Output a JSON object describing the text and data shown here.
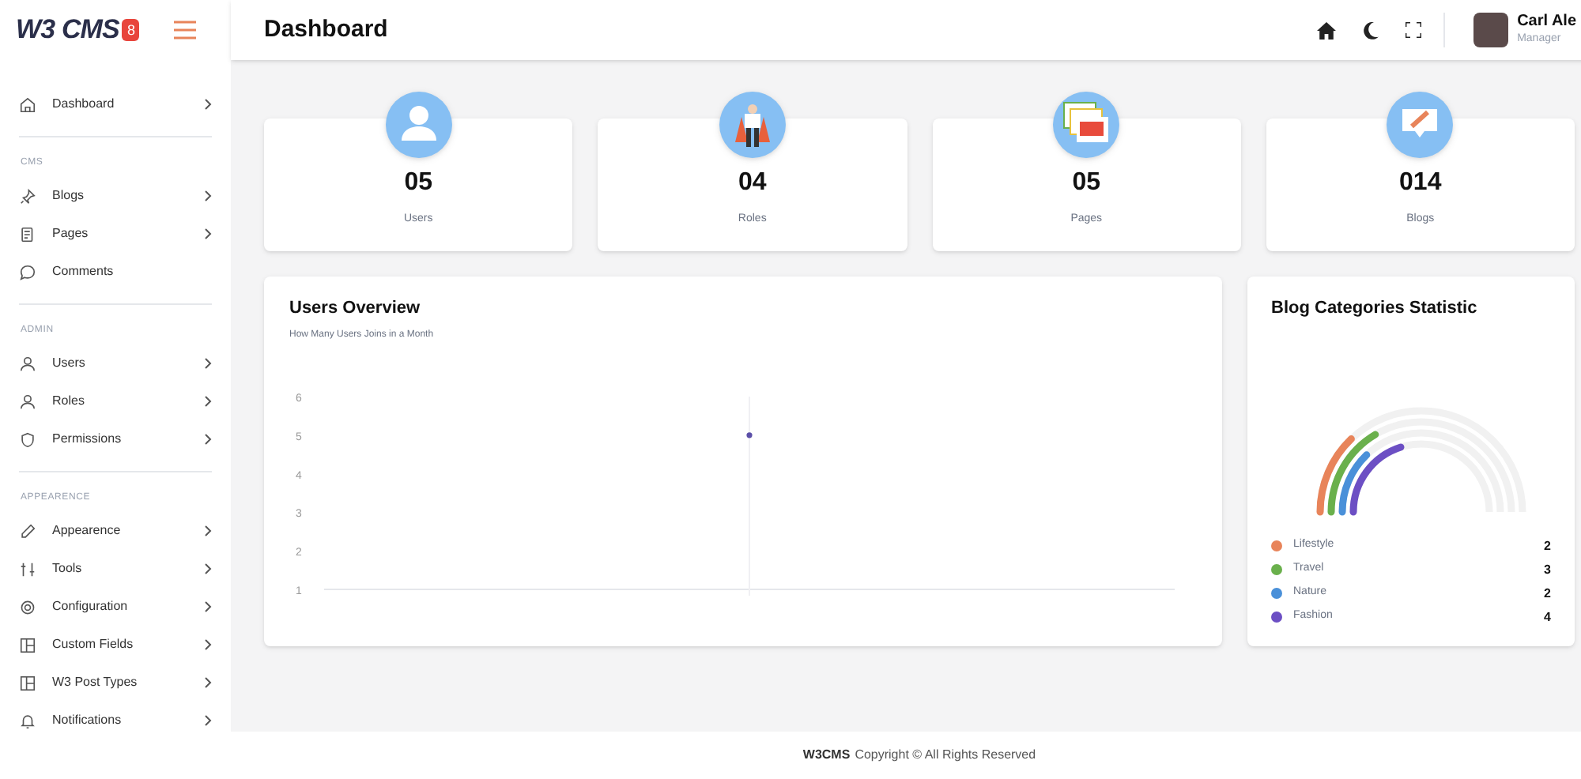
{
  "logo": {
    "text": "W3 CMS",
    "badge": "8"
  },
  "header": {
    "title": "Dashboard",
    "user": {
      "name": "Carl Ale",
      "role": "Manager"
    }
  },
  "sidebar": {
    "sections": [
      {
        "items": [
          {
            "label": "Dashboard",
            "has_submenu": true
          }
        ]
      },
      {
        "heading": "CMS",
        "items": [
          {
            "label": "Blogs",
            "has_submenu": true
          },
          {
            "label": "Pages",
            "has_submenu": true
          },
          {
            "label": "Comments",
            "has_submenu": false
          }
        ]
      },
      {
        "heading": "ADMIN",
        "items": [
          {
            "label": "Users",
            "has_submenu": true
          },
          {
            "label": "Roles",
            "has_submenu": true
          },
          {
            "label": "Permissions",
            "has_submenu": true
          }
        ]
      },
      {
        "heading": "APPEARENCE",
        "items": [
          {
            "label": "Appearence",
            "has_submenu": true
          },
          {
            "label": "Tools",
            "has_submenu": true
          },
          {
            "label": "Configuration",
            "has_submenu": true
          },
          {
            "label": "Custom Fields",
            "has_submenu": true
          },
          {
            "label": "W3 Post Types",
            "has_submenu": true
          },
          {
            "label": "Notifications",
            "has_submenu": true
          }
        ]
      }
    ]
  },
  "stats": [
    {
      "value": "05",
      "label": "Users"
    },
    {
      "value": "04",
      "label": "Roles"
    },
    {
      "value": "05",
      "label": "Pages"
    },
    {
      "value": "014",
      "label": "Blogs"
    }
  ],
  "users_overview": {
    "title": "Users Overview",
    "subtitle": "How Many Users Joins in a Month",
    "chart_data": {
      "type": "line",
      "marker": true,
      "ylim": [
        1,
        6
      ],
      "yticks": [
        1,
        2,
        3,
        4,
        5,
        6
      ],
      "values": [
        5
      ]
    }
  },
  "blog_categories": {
    "title": "Blog Categories Statistic",
    "legend": [
      {
        "label": "Lifestyle",
        "count": "2",
        "color": "#e8845a"
      },
      {
        "label": "Travel",
        "count": "3",
        "color": "#6ab04c"
      },
      {
        "label": "Nature",
        "count": "2",
        "color": "#4a90d9"
      },
      {
        "label": "Fashion",
        "count": "4",
        "color": "#6c4fc4"
      }
    ]
  },
  "footer": {
    "brand": "W3CMS",
    "text": "Copyright © All Rights Reserved"
  }
}
